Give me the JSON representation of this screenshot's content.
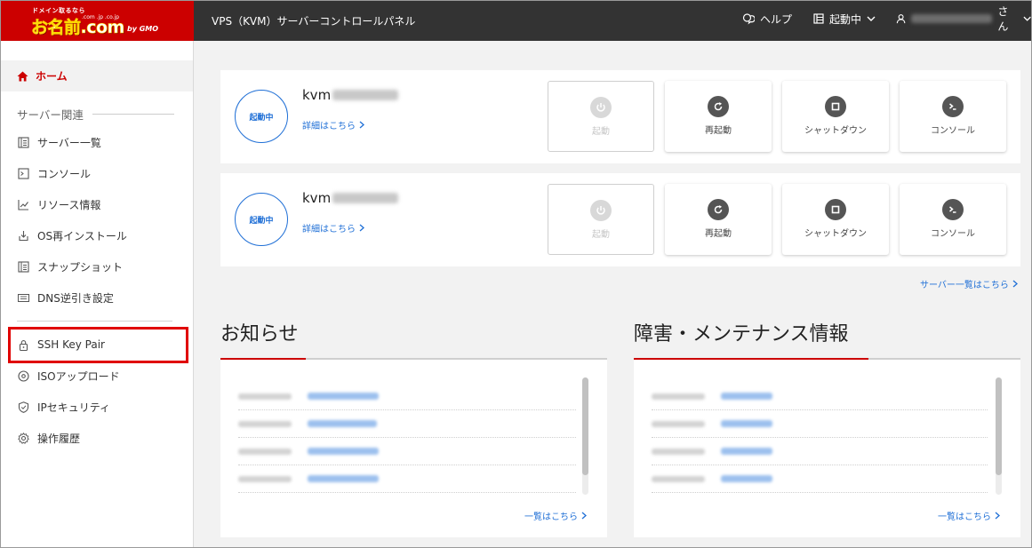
{
  "header": {
    "logo_tagline": "ドメイン取るなら",
    "logo_main": "お名前.com",
    "logo_sub": ".com .jp .co.jp",
    "logo_by": "by GMO",
    "title": "VPS（KVM）サーバーコントロールパネル",
    "help_label": "ヘルプ",
    "status_label": "起動中",
    "user_suffix": "さん"
  },
  "sidebar": {
    "home_label": "ホーム",
    "group_label": "サーバー関連",
    "items": [
      {
        "label": "サーバー一覧",
        "icon": "server-list-icon"
      },
      {
        "label": "コンソール",
        "icon": "console-icon"
      },
      {
        "label": "リソース情報",
        "icon": "resource-chart-icon"
      },
      {
        "label": "OS再インストール",
        "icon": "reinstall-icon"
      },
      {
        "label": "スナップショット",
        "icon": "snapshot-icon"
      },
      {
        "label": "DNS逆引き設定",
        "icon": "dns-icon"
      },
      {
        "label": "SSH Key Pair",
        "icon": "lock-icon"
      },
      {
        "label": "ISOアップロード",
        "icon": "disc-icon"
      },
      {
        "label": "IPセキュリティ",
        "icon": "shield-icon"
      },
      {
        "label": "操作履歴",
        "icon": "gear-icon"
      }
    ]
  },
  "servers": [
    {
      "status": "起動中",
      "name": "kvm",
      "detail_label": "詳細はこちら"
    },
    {
      "status": "起動中",
      "name": "kvm",
      "detail_label": "詳細はこちら"
    }
  ],
  "actions": {
    "start": "起動",
    "restart": "再起動",
    "shutdown": "シャットダウン",
    "console": "コンソール"
  },
  "server_list_link": "サーバー一覧はこちら",
  "news": {
    "title": "お知らせ",
    "more_label": "一覧はこちら"
  },
  "maintenance": {
    "title": "障害・メンテナンス情報",
    "more_label": "一覧はこちら"
  },
  "colors": {
    "brand_red": "#cc0000",
    "header_dark": "#333333",
    "link_blue": "#1f6fd6",
    "highlight_red": "#e00000"
  }
}
